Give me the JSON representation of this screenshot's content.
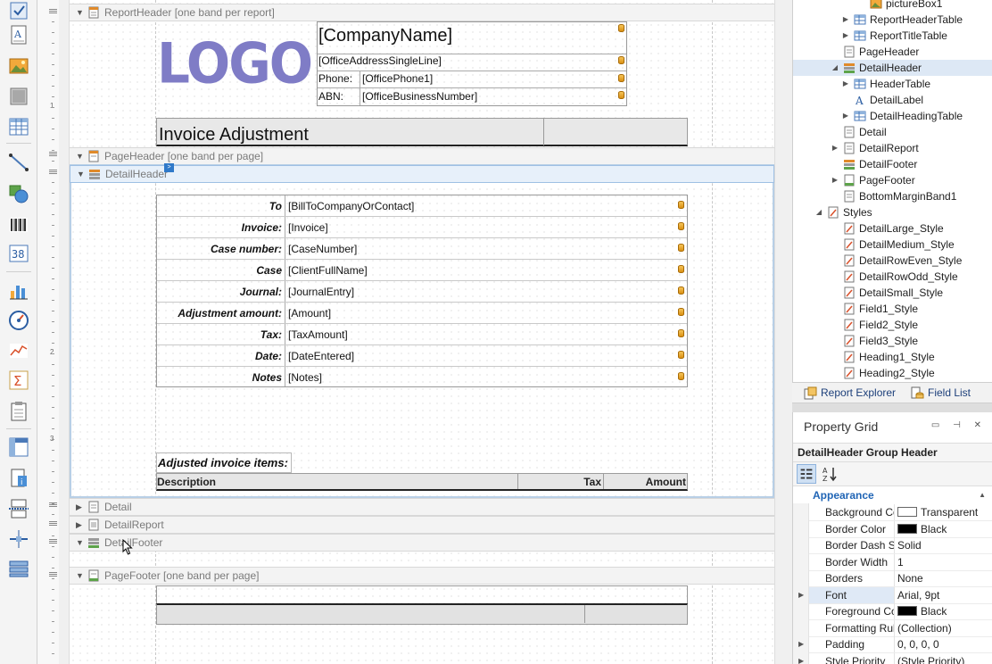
{
  "toolbox": {
    "items": [
      "label-tool",
      "richtext-tool",
      "picture-tool",
      "panel-tool",
      "table-tool",
      "line-tool",
      "shape-tool",
      "barcode-tool",
      "zipcode-tool",
      "chart-tool",
      "gauge-tool",
      "sparkline-tool",
      "summary-tool",
      "subreport-tool",
      "pivot-tool",
      "pageinfo-tool",
      "pagebreak-tool",
      "crossband-line-tool",
      "crossband-box-tool"
    ]
  },
  "ruler": {
    "marks": [
      "1",
      "2",
      "3"
    ]
  },
  "bands": {
    "report_header": "ReportHeader [one band per report]",
    "page_header": "PageHeader [one band per page]",
    "detail_header": "DetailHeader",
    "detail": "Detail",
    "detail_report": "DetailReport",
    "detail_footer": "DetailFooter",
    "page_footer": "PageFooter [one band per page]"
  },
  "report_header": {
    "logo_text": "LOGO",
    "company_name": "[CompanyName]",
    "office_address": "[OfficeAddressSingleLine]",
    "phone_label": "Phone:",
    "phone_value": "[OfficePhone1]",
    "abn_label": "ABN:",
    "abn_value": "[OfficeBusinessNumber]",
    "title": "Invoice Adjustment"
  },
  "detail_table": {
    "rows": [
      {
        "label": "To",
        "value": "[BillToCompanyOrContact]"
      },
      {
        "label": "Invoice:",
        "value": "[Invoice]"
      },
      {
        "label": "Case number:",
        "value": "[CaseNumber]"
      },
      {
        "label": "Case",
        "value": "[ClientFullName]"
      },
      {
        "label": "Journal:",
        "value": "[JournalEntry]"
      },
      {
        "label": "Adjustment amount:",
        "value": "[Amount]"
      },
      {
        "label": "Tax:",
        "value": "[TaxAmount]"
      },
      {
        "label": "Date:",
        "value": "[DateEntered]"
      },
      {
        "label": "Notes",
        "value": "[Notes]"
      }
    ]
  },
  "items": {
    "label": "Adjusted invoice items:",
    "col_description": "Description",
    "col_tax": "Tax",
    "col_amount": "Amount"
  },
  "explorer": {
    "nodes": [
      {
        "label": "pictureBox1",
        "icon": "picture",
        "expander": ""
      },
      {
        "label": "ReportHeaderTable",
        "icon": "table",
        "expander": "▶"
      },
      {
        "label": "ReportTitleTable",
        "icon": "table",
        "expander": "▶"
      },
      {
        "label": "PageHeader",
        "icon": "band",
        "expander": ""
      },
      {
        "label": "DetailHeader",
        "icon": "group-band",
        "expander": "◢"
      },
      {
        "label": "HeaderTable",
        "icon": "table",
        "expander": "▶"
      },
      {
        "label": "DetailLabel",
        "icon": "label",
        "expander": ""
      },
      {
        "label": "DetailHeadingTable",
        "icon": "table",
        "expander": "▶"
      },
      {
        "label": "Detail",
        "icon": "band",
        "expander": ""
      },
      {
        "label": "DetailReport",
        "icon": "band",
        "expander": "▶"
      },
      {
        "label": "DetailFooter",
        "icon": "group-band",
        "expander": ""
      },
      {
        "label": "PageFooter",
        "icon": "footer-band",
        "expander": "▶"
      },
      {
        "label": "BottomMarginBand1",
        "icon": "band",
        "expander": ""
      },
      {
        "label": "Styles",
        "icon": "style",
        "expander": "◢"
      },
      {
        "label": "DetailLarge_Style",
        "icon": "style",
        "expander": ""
      },
      {
        "label": "DetailMedium_Style",
        "icon": "style",
        "expander": ""
      },
      {
        "label": "DetailRowEven_Style",
        "icon": "style",
        "expander": ""
      },
      {
        "label": "DetailRowOdd_Style",
        "icon": "style",
        "expander": ""
      },
      {
        "label": "DetailSmall_Style",
        "icon": "style",
        "expander": ""
      },
      {
        "label": "Field1_Style",
        "icon": "style",
        "expander": ""
      },
      {
        "label": "Field2_Style",
        "icon": "style",
        "expander": ""
      },
      {
        "label": "Field3_Style",
        "icon": "style",
        "expander": ""
      },
      {
        "label": "Heading1_Style",
        "icon": "style",
        "expander": ""
      },
      {
        "label": "Heading2_Style",
        "icon": "style",
        "expander": ""
      }
    ]
  },
  "panel_tabs": {
    "report_explorer": "Report Explorer",
    "field_list": "Field List"
  },
  "property_grid": {
    "title": "Property Grid",
    "selected_object": "DetailHeader   Group Header",
    "category": "Appearance",
    "rows": [
      {
        "name": "Background Color",
        "value": "Transparent",
        "swatch": "#ffffff",
        "expander": ""
      },
      {
        "name": "Border Color",
        "value": "Black",
        "swatch": "#000000",
        "expander": ""
      },
      {
        "name": "Border Dash Style",
        "value": "Solid",
        "swatch": "",
        "expander": ""
      },
      {
        "name": "Border Width",
        "value": "1",
        "swatch": "",
        "expander": ""
      },
      {
        "name": "Borders",
        "value": "None",
        "swatch": "",
        "expander": ""
      },
      {
        "name": "Font",
        "value": "Arial, 9pt",
        "swatch": "",
        "expander": "▶"
      },
      {
        "name": "Foreground Color",
        "value": "Black",
        "swatch": "#000000",
        "expander": ""
      },
      {
        "name": "Formatting Rules",
        "value": "(Collection)",
        "swatch": "",
        "expander": ""
      },
      {
        "name": "Padding",
        "value": "0, 0, 0, 0",
        "swatch": "",
        "expander": "▶"
      },
      {
        "name": "Style Priority",
        "value": "(Style Priority)",
        "swatch": "",
        "expander": "▶"
      }
    ]
  },
  "colors": {
    "accent": "#1f64b5",
    "logo": "#7f7cc6",
    "selection": "#dde8f5"
  }
}
